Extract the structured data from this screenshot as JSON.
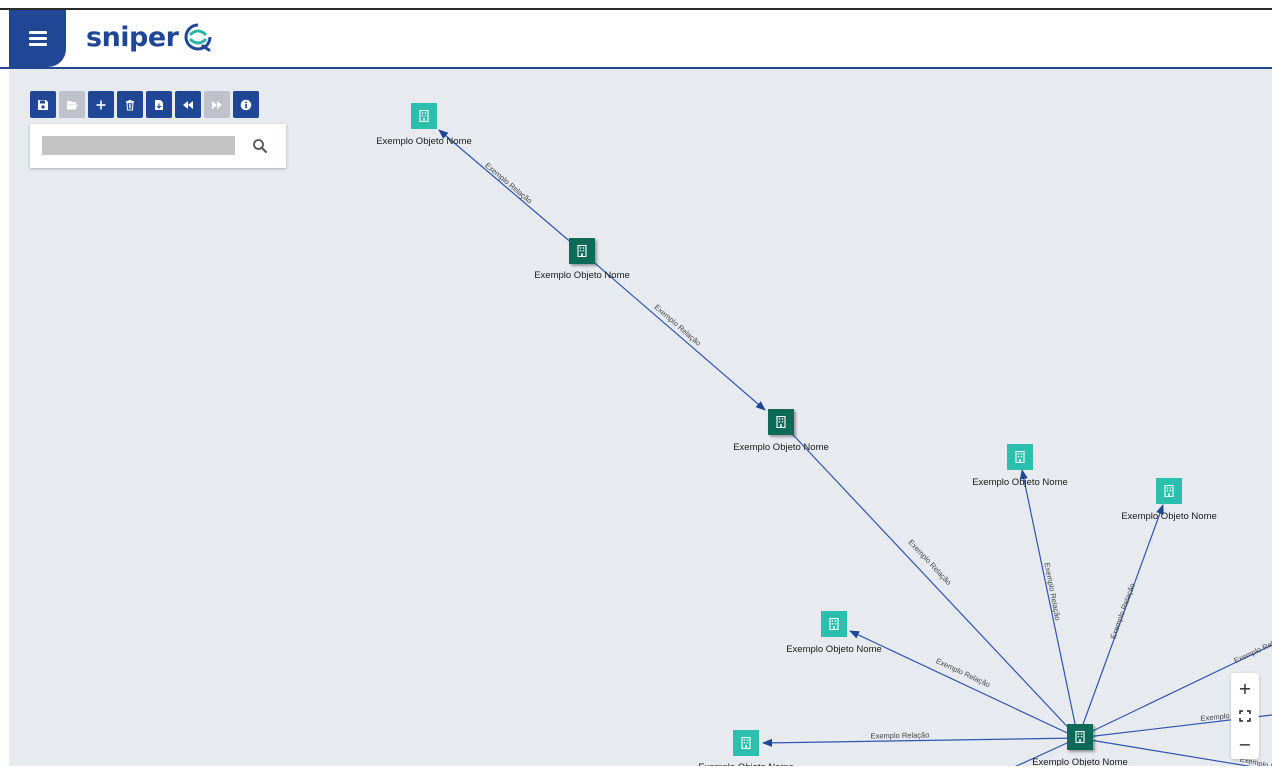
{
  "header": {
    "logo_text": "sniper",
    "menu_icon": "hamburger-icon",
    "brand_color": "#1f4796",
    "accent_color": "#2bb3a6"
  },
  "toolbar": {
    "buttons": [
      {
        "name": "save",
        "icon": "floppy-disk-icon",
        "enabled": true
      },
      {
        "name": "open",
        "icon": "folder-open-icon",
        "enabled": false
      },
      {
        "name": "add",
        "icon": "plus-icon",
        "enabled": true
      },
      {
        "name": "delete",
        "icon": "trash-icon",
        "enabled": true
      },
      {
        "name": "export",
        "icon": "file-icon",
        "enabled": true
      },
      {
        "name": "back",
        "icon": "backward-icon",
        "enabled": true
      },
      {
        "name": "forward",
        "icon": "forward-icon",
        "enabled": false
      },
      {
        "name": "info",
        "icon": "info-circle-icon",
        "enabled": true
      }
    ]
  },
  "search": {
    "value": "",
    "placeholder": "",
    "icon": "search-icon"
  },
  "graph": {
    "node_color_light": "#2bbfae",
    "node_color_dark": "#0e6b58",
    "edge_color": "#2e56b0",
    "node_label": "Exemplo Objeto Nome",
    "edge_label": "Exemplo Relação",
    "node_icon": "building-icon"
  },
  "zoom": {
    "zoom_in_label": "+",
    "fit_icon": "fit-screen-icon",
    "zoom_out_label": "−"
  }
}
